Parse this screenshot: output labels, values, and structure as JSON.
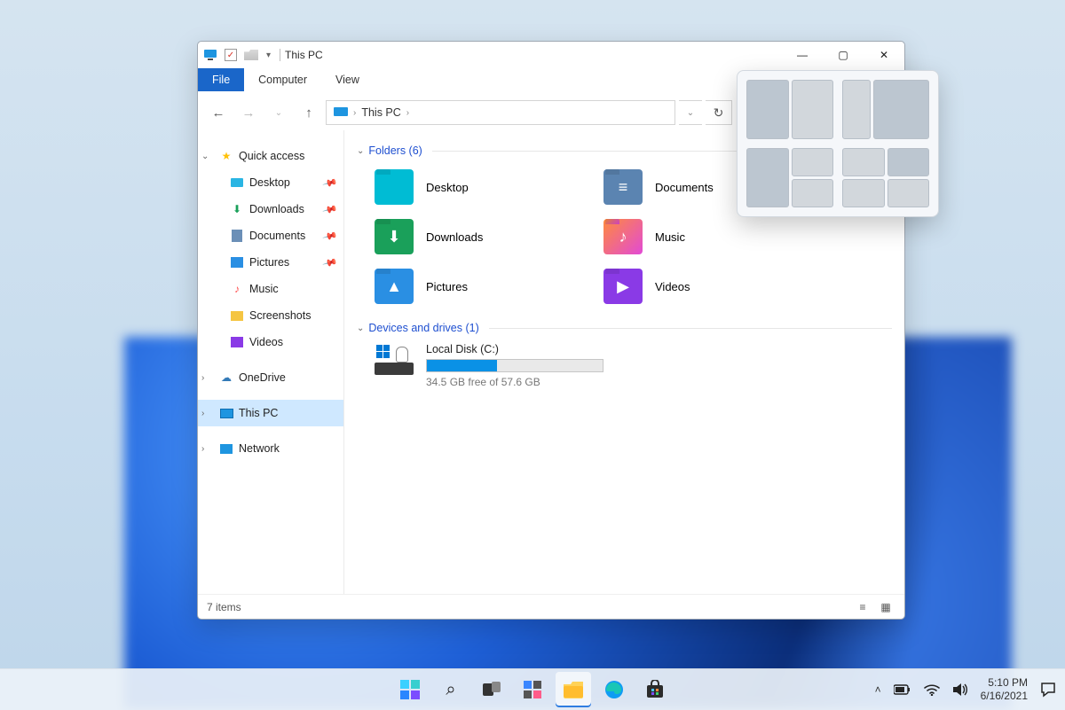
{
  "titlebar": {
    "title": "This PC"
  },
  "window_controls": {
    "minimize": "—",
    "maximize": "▢",
    "close": "✕"
  },
  "ribbon": {
    "tabs": [
      "File",
      "Computer",
      "View"
    ]
  },
  "breadcrumb": {
    "location": "This PC"
  },
  "sidebar": {
    "quick_access": "Quick access",
    "items": [
      "Desktop",
      "Downloads",
      "Documents",
      "Pictures",
      "Music",
      "Screenshots",
      "Videos"
    ],
    "onedrive": "OneDrive",
    "this_pc": "This PC",
    "network": "Network"
  },
  "sections": {
    "folders_h": "Folders (6)",
    "drives_h": "Devices and drives (1)"
  },
  "folders": [
    "Desktop",
    "Documents",
    "Downloads",
    "Music",
    "Pictures",
    "Videos"
  ],
  "drive": {
    "name": "Local Disk (C:)",
    "free_text": "34.5 GB free of 57.6 GB",
    "used_pct": 40
  },
  "status": {
    "items": "7 items"
  },
  "taskbar": {
    "time": "5:10 PM",
    "date": "6/16/2021"
  }
}
